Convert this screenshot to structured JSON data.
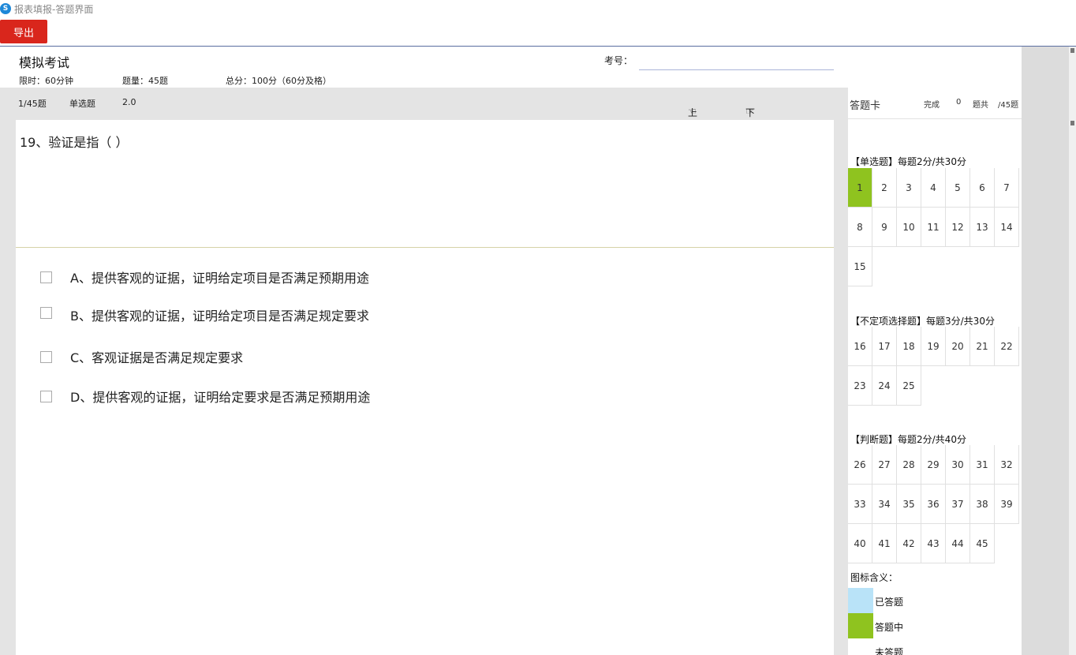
{
  "window": {
    "title": "报表填报-答题界面"
  },
  "toolbar": {
    "export_label": "导出"
  },
  "exam": {
    "title": "模拟考试",
    "time_limit": "限时：60分钟",
    "question_count": "题量：45题",
    "total_score": "总分：100分（60分及格）",
    "exam_no_label": "考号：",
    "exam_no_value": ""
  },
  "question_bar": {
    "progress": "1/45题",
    "type": "单选题",
    "score": "2.0",
    "prev_label": "上一题",
    "next_label": "下一题"
  },
  "question": {
    "text": "19、验证是指（     ）",
    "options": [
      {
        "label": "A、提供客观的证据，证明给定项目是否满足预期用途",
        "checked": false
      },
      {
        "label": "B、提供客观的证据，证明给定项目是否满足规定要求",
        "checked": false
      },
      {
        "label": "C、客观证据是否满足规定要求",
        "checked": false
      },
      {
        "label": "D、提供客观的证据，证明给定要求是否满足预期用途",
        "checked": false
      }
    ]
  },
  "answer_card": {
    "title": "答题卡",
    "completed_label": "完成",
    "completed_count": "0",
    "total_label": "题共",
    "total_value": "/45题",
    "sections": [
      {
        "label": "【单选题】每题2分/共30分",
        "numbers": [
          "1",
          "2",
          "3",
          "4",
          "5",
          "6",
          "7",
          "8",
          "9",
          "10",
          "11",
          "12",
          "13",
          "14",
          "15"
        ]
      },
      {
        "label": "【不定项选择题】每题3分/共30分",
        "numbers": [
          "16",
          "17",
          "18",
          "19",
          "20",
          "21",
          "22",
          "23",
          "24",
          "25"
        ]
      },
      {
        "label": "【判断题】每题2分/共40分",
        "numbers": [
          "26",
          "27",
          "28",
          "29",
          "30",
          "31",
          "32",
          "33",
          "34",
          "35",
          "36",
          "37",
          "38",
          "39",
          "40",
          "41",
          "42",
          "43",
          "44",
          "45"
        ]
      }
    ],
    "current_question": "1",
    "legend": {
      "title": "图标含义：",
      "items": [
        {
          "label": "已答题",
          "color": "#b9e3f8"
        },
        {
          "label": "答题中",
          "color": "#8fc31f"
        },
        {
          "label": "未答题",
          "color": "#ffffff"
        }
      ]
    }
  }
}
